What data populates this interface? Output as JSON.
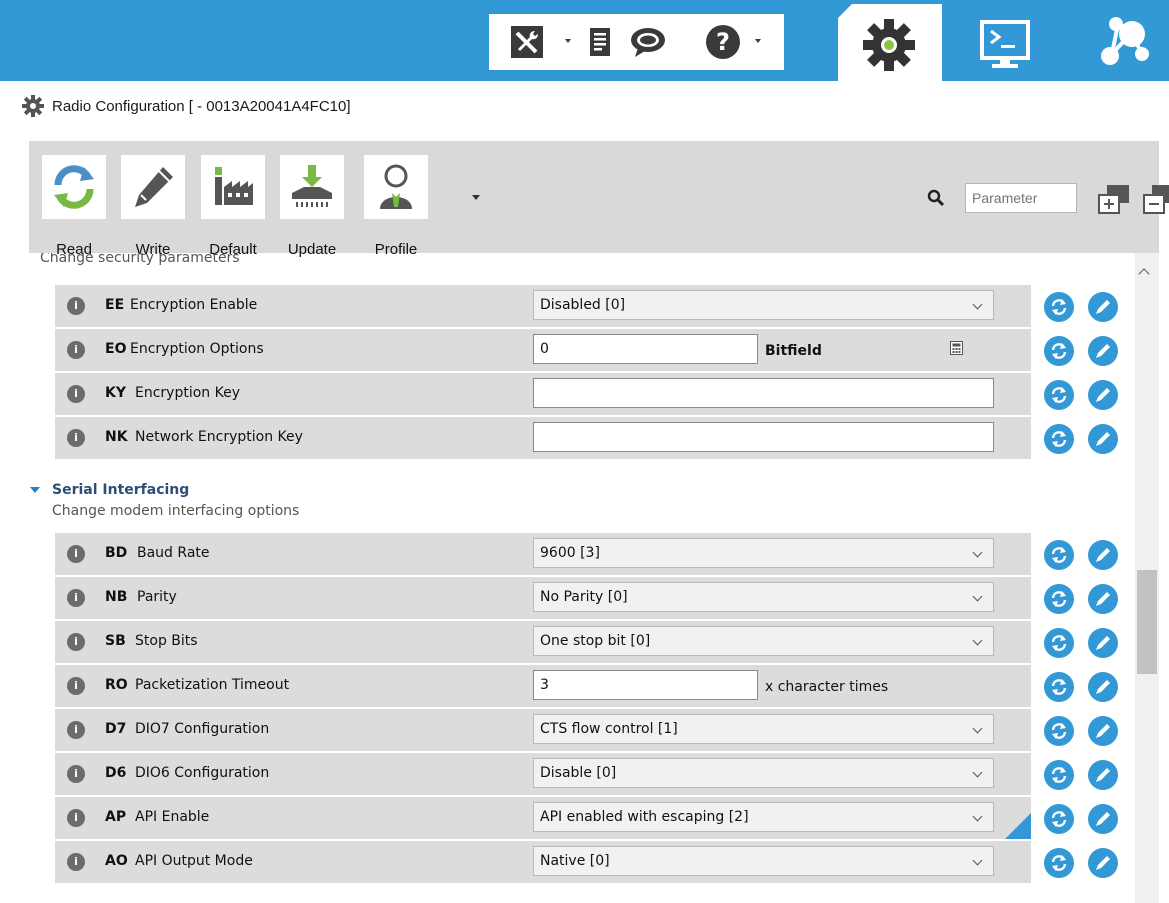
{
  "window": {
    "title": "Radio Configuration [ - 0013A20041A4FC10]"
  },
  "toolbar": {
    "buttons": [
      {
        "label": "Read",
        "icon": "read-icon"
      },
      {
        "label": "Write",
        "icon": "write-icon"
      },
      {
        "label": "Default",
        "icon": "factory-icon"
      },
      {
        "label": "Update",
        "icon": "update-firmware-icon"
      },
      {
        "label": "Profile",
        "icon": "profile-icon"
      }
    ],
    "search_placeholder": "Parameter"
  },
  "sections": {
    "security": {
      "description": "Change security parameters",
      "rows": [
        {
          "code": "EE",
          "name": "Encryption Enable",
          "type": "select",
          "value": "Disabled [0]"
        },
        {
          "code": "EO",
          "name": "Encryption Options",
          "type": "text",
          "value": "0",
          "unit": "Bitfield"
        },
        {
          "code": "KY",
          "name": "Encryption Key",
          "type": "text-wide",
          "value": ""
        },
        {
          "code": "NK",
          "name": "Network Encryption Key",
          "type": "text-wide",
          "value": ""
        }
      ]
    },
    "serial": {
      "title": "Serial Interfacing",
      "description": "Change modem interfacing options",
      "rows": [
        {
          "code": "BD",
          "name": "Baud Rate",
          "type": "select",
          "value": "9600 [3]"
        },
        {
          "code": "NB",
          "name": "Parity",
          "type": "select",
          "value": "No Parity [0]"
        },
        {
          "code": "SB",
          "name": "Stop Bits",
          "type": "select",
          "value": "One stop bit [0]"
        },
        {
          "code": "RO",
          "name": "Packetization Timeout",
          "type": "text",
          "value": "3",
          "unit": "x character times"
        },
        {
          "code": "D7",
          "name": "DIO7 Configuration",
          "type": "select",
          "value": "CTS flow control [1]"
        },
        {
          "code": "D6",
          "name": "DIO6 Configuration",
          "type": "select",
          "value": "Disable [0]"
        },
        {
          "code": "AP",
          "name": "API Enable",
          "type": "select",
          "value": "API enabled with escaping [2]",
          "modified": true
        },
        {
          "code": "AO",
          "name": "API Output Mode",
          "type": "select",
          "value": "Native [0]"
        }
      ]
    }
  },
  "colors": {
    "accent": "#3399d6",
    "row_bg": "#dcdcdc",
    "toolbar_bg": "#d9d9d9"
  }
}
